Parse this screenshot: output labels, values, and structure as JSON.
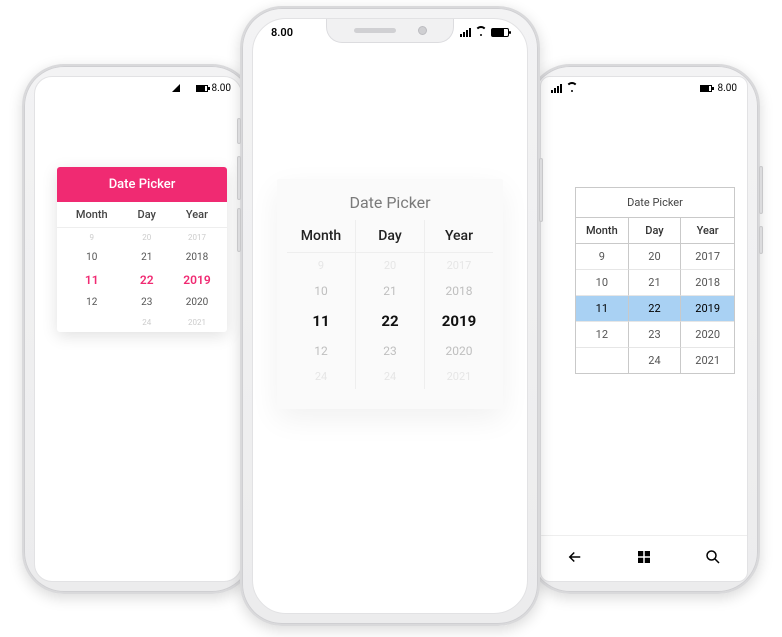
{
  "status": {
    "time_android": "8.00",
    "time_ios": "8.00",
    "time_wp": "8.00"
  },
  "left": {
    "title": "Date Picker",
    "headers": {
      "month": "Month",
      "day": "Day",
      "year": "Year"
    },
    "rows": [
      {
        "m": "9",
        "d": "20",
        "y": "2017",
        "cls": "faint"
      },
      {
        "m": "10",
        "d": "21",
        "y": "2018",
        "cls": ""
      },
      {
        "m": "11",
        "d": "22",
        "y": "2019",
        "cls": "sel"
      },
      {
        "m": "12",
        "d": "23",
        "y": "2020",
        "cls": ""
      },
      {
        "m": "",
        "d": "24",
        "y": "2021",
        "cls": "faint"
      }
    ]
  },
  "center": {
    "title": "Date Picker",
    "headers": {
      "month": "Month",
      "day": "Day",
      "year": "Year"
    },
    "month": [
      "9",
      "10",
      "11",
      "12",
      "24"
    ],
    "day": [
      "20",
      "21",
      "22",
      "23",
      "24"
    ],
    "year": [
      "2017",
      "2018",
      "2019",
      "2020",
      "2021"
    ],
    "sel_index": 2
  },
  "right": {
    "title": "Date Picker",
    "headers": {
      "month": "Month",
      "day": "Day",
      "year": "Year"
    },
    "rows": [
      {
        "m": "9",
        "d": "20",
        "y": "2017"
      },
      {
        "m": "10",
        "d": "21",
        "y": "2018"
      },
      {
        "m": "11",
        "d": "22",
        "y": "2019"
      },
      {
        "m": "12",
        "d": "23",
        "y": "2020"
      },
      {
        "m": "",
        "d": "24",
        "y": "2021"
      }
    ],
    "sel_index": 2
  },
  "colors": {
    "accent_left": "#f02a72",
    "accent_right": "#a9d1f3"
  }
}
